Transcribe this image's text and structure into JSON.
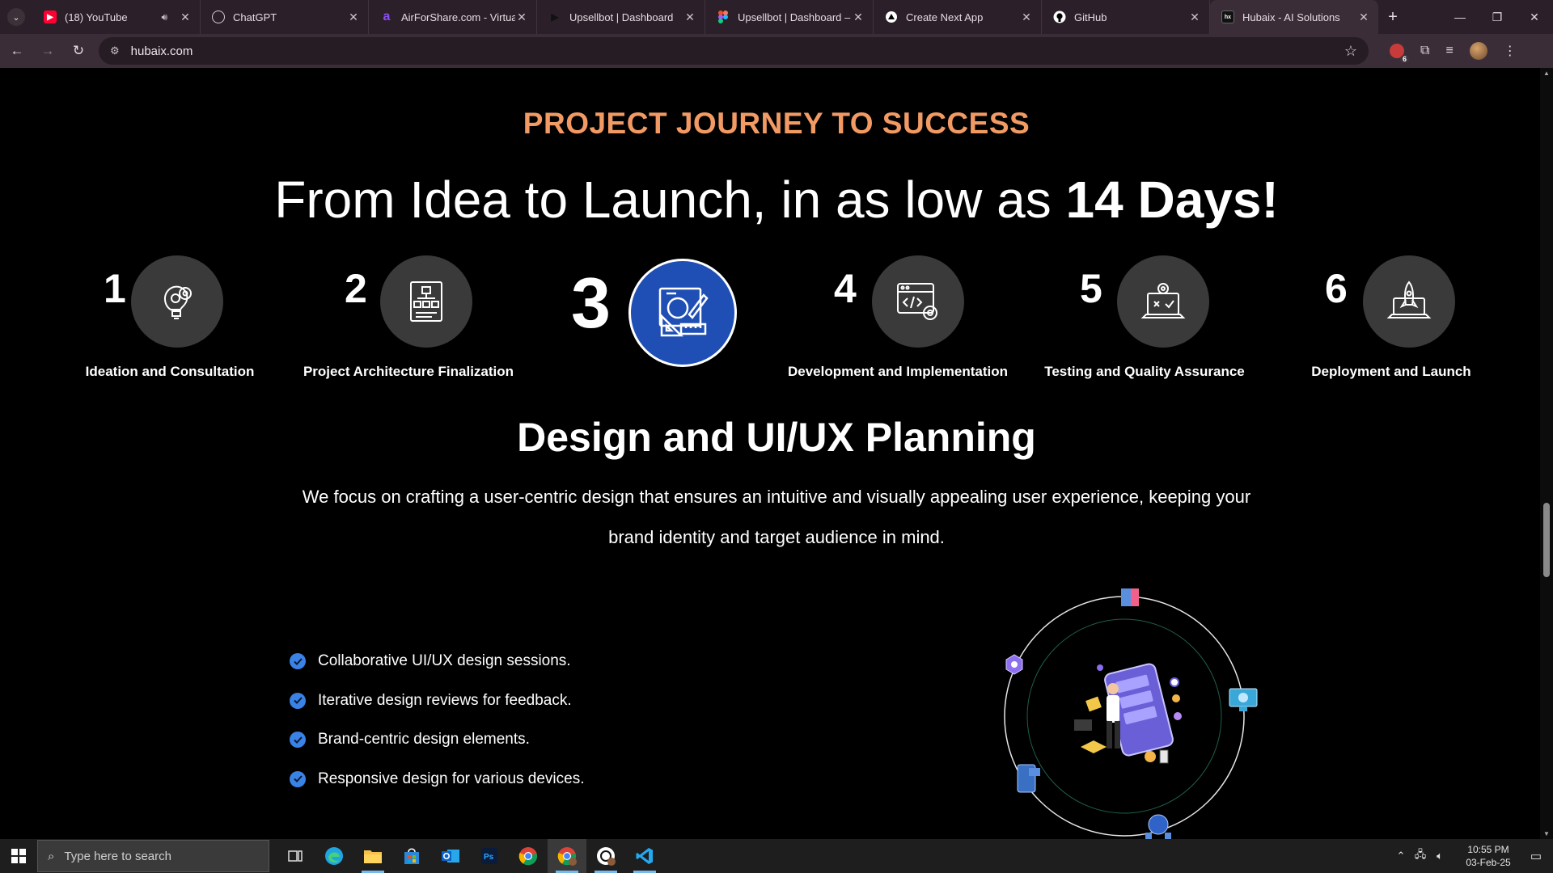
{
  "browser": {
    "tabs": [
      {
        "label": "(18) YouTube",
        "icon": "youtube-icon",
        "color": "#ff0033",
        "audio": true
      },
      {
        "label": "ChatGPT",
        "icon": "chatgpt-icon",
        "color": "#cfcfcf"
      },
      {
        "label": "AirForShare.com - Virtual",
        "icon": "airforshare-icon",
        "color": "#7b3fe4"
      },
      {
        "label": "Upsellbot | Dashboard",
        "icon": "play-icon",
        "color": "#222222"
      },
      {
        "label": "Upsellbot | Dashboard – F",
        "icon": "figma-icon",
        "color": "#f24e1e"
      },
      {
        "label": "Create Next App",
        "icon": "vercel-icon",
        "color": "#ffffff"
      },
      {
        "label": "GitHub",
        "icon": "github-icon",
        "color": "#ffffff"
      },
      {
        "label": "Hubaix - AI Solutions",
        "icon": "hubaix-icon",
        "color": "#ffffff",
        "active": true
      }
    ],
    "url": "hubaix.com",
    "extension_badge": "6"
  },
  "page": {
    "eyebrow": "PROJECT JOURNEY TO SUCCESS",
    "headline_regular": "From Idea to Launch, in as low as ",
    "headline_bold": "14 Days!",
    "steps": [
      {
        "number": "1",
        "label": "Ideation and Consultation",
        "icon": "lightbulb-gear-icon"
      },
      {
        "number": "2",
        "label": "Project Architecture Finalization",
        "icon": "architecture-document-icon"
      },
      {
        "number": "3",
        "label": "",
        "icon": "design-tools-icon",
        "active": true
      },
      {
        "number": "4",
        "label": "Development and Implementation",
        "icon": "code-window-gear-icon"
      },
      {
        "number": "5",
        "label": "Testing and Quality Assurance",
        "icon": "testing-laptop-icon"
      },
      {
        "number": "6",
        "label": "Deployment and Launch",
        "icon": "rocket-laptop-icon"
      }
    ],
    "active_step_title": "Design and UI/UX Planning",
    "active_step_description": "We focus on crafting a user-centric design that ensures an intuitive and visually appealing user experience, keeping your brand identity and target audience in mind.",
    "features": [
      "Collaborative UI/UX design sessions.",
      "Iterative design reviews for feedback.",
      "Brand-centric design elements.",
      "Responsive design for various devices."
    ],
    "accent_color": "#f29a63",
    "active_color": "#1f4fb4"
  },
  "taskbar": {
    "search_placeholder": "Type here to search",
    "time": "10:55 PM",
    "date": "03-Feb-25"
  }
}
